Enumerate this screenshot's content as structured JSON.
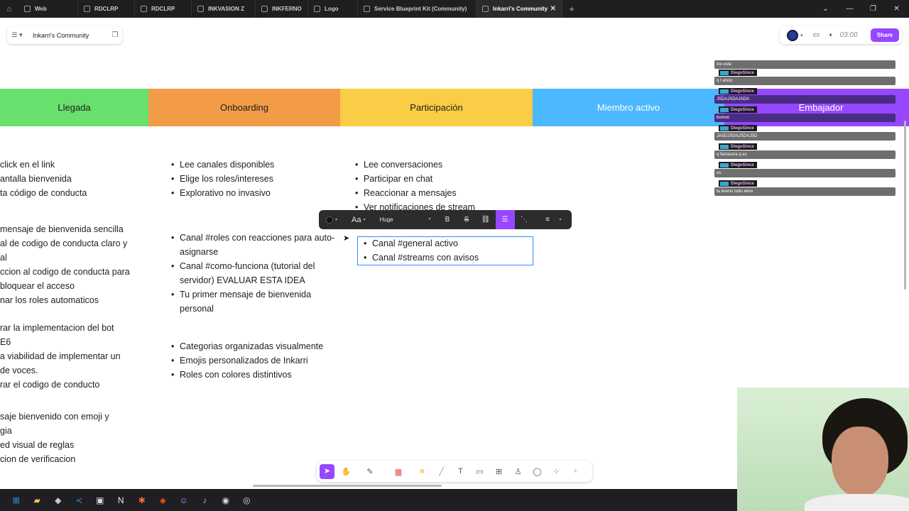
{
  "browser": {
    "tabs": [
      {
        "label": "Web"
      },
      {
        "label": "RDCLRP"
      },
      {
        "label": "RDCLRP"
      },
      {
        "label": "INKVASION Z"
      },
      {
        "label": "INKFERNO"
      },
      {
        "label": "Logo"
      },
      {
        "label": "Service Blueprint Kit (Community)"
      },
      {
        "label": "Inkarri's Community"
      }
    ],
    "new_tab": "+"
  },
  "file": {
    "name": "Inkarri's Community"
  },
  "toolbar_right": {
    "timer": "03:00",
    "share_label": "Share"
  },
  "stages": [
    {
      "label": "Llegada",
      "color": "#69e06e",
      "text_color": "#1e1e1e"
    },
    {
      "label": "Onboarding",
      "color": "#f39c47",
      "text_color": "#1e1e1e"
    },
    {
      "label": "Participación",
      "color": "#f9cd46",
      "text_color": "#1e1e1e"
    },
    {
      "label": "Miembro activo",
      "color": "#4cb8ff",
      "text_color": "#ffffff"
    },
    {
      "label": "Embajador",
      "color": "#9747ff",
      "text_color": "#ffffff"
    }
  ],
  "columns": {
    "llegada": {
      "group1": [
        "click en el link",
        "antalla bienvenida",
        "ta código de conducta"
      ],
      "group2": [
        "mensaje de bienvenida sencilla",
        "al de codigo de conducta claro y",
        "al",
        "ccion al codigo de conducta para",
        "bloquear el acceso",
        "nar los roles automaticos"
      ],
      "group3": [
        "rar la implementacion del bot",
        "E6",
        "a viabilidad de implementar un",
        "de voces.",
        "rar el codigo de conducto"
      ],
      "group4": [
        "saje bienvenido con emoji y",
        "gia",
        "ed visual de reglas",
        "cion de verificacion"
      ]
    },
    "onboarding": {
      "group1": [
        "Lee canales disponibles",
        "Elige los roles/intereses",
        "Explorativo no invasivo"
      ],
      "group2": [
        "Canal #roles con reacciones para auto-asignarse",
        "Canal #como-funciona (tutorial del servidor) EVALUAR ESTA IDEA",
        "Tu primer mensaje de bienvenida personal"
      ],
      "group3": [
        "Categorias organizadas visualmente",
        "Emojis personalizados de Inkarri",
        "Roles con colores distintivos"
      ]
    },
    "participacion": {
      "group1": [
        "Lee conversaciones",
        "Participar en chat",
        "Reaccionar a mensajes",
        "Ver notificaciones de stream"
      ],
      "editing": [
        "Canal #general activo",
        "Canal #streams con avisos"
      ]
    }
  },
  "text_toolbar": {
    "font_label": "Aa",
    "size_label": "Huge",
    "bold": "B",
    "strike": "S"
  },
  "chat": {
    "messages": [
      {
        "user": "",
        "text": "ino este"
      },
      {
        "user": "DiegoSince",
        "text": "q t anoic"
      },
      {
        "user": "DiegoSince",
        "text": "JSDAJSDAJSDA"
      },
      {
        "user": "DiegoSince",
        "text": "bumoo"
      },
      {
        "user": "DiegoSince",
        "text": "JASDJSDAJSDAJSD"
      },
      {
        "user": "DiegoSince",
        "text": "q fantasma q es"
      },
      {
        "user": "DiegoSince",
        "text": "es"
      },
      {
        "user": "DiegoSince",
        "text": "ta bueno todo aivre"
      }
    ]
  },
  "icons": {
    "home": "home-icon",
    "menu": "menu-icon",
    "pages": "pages-icon",
    "present": "present-icon",
    "timer": "timer-icon"
  }
}
